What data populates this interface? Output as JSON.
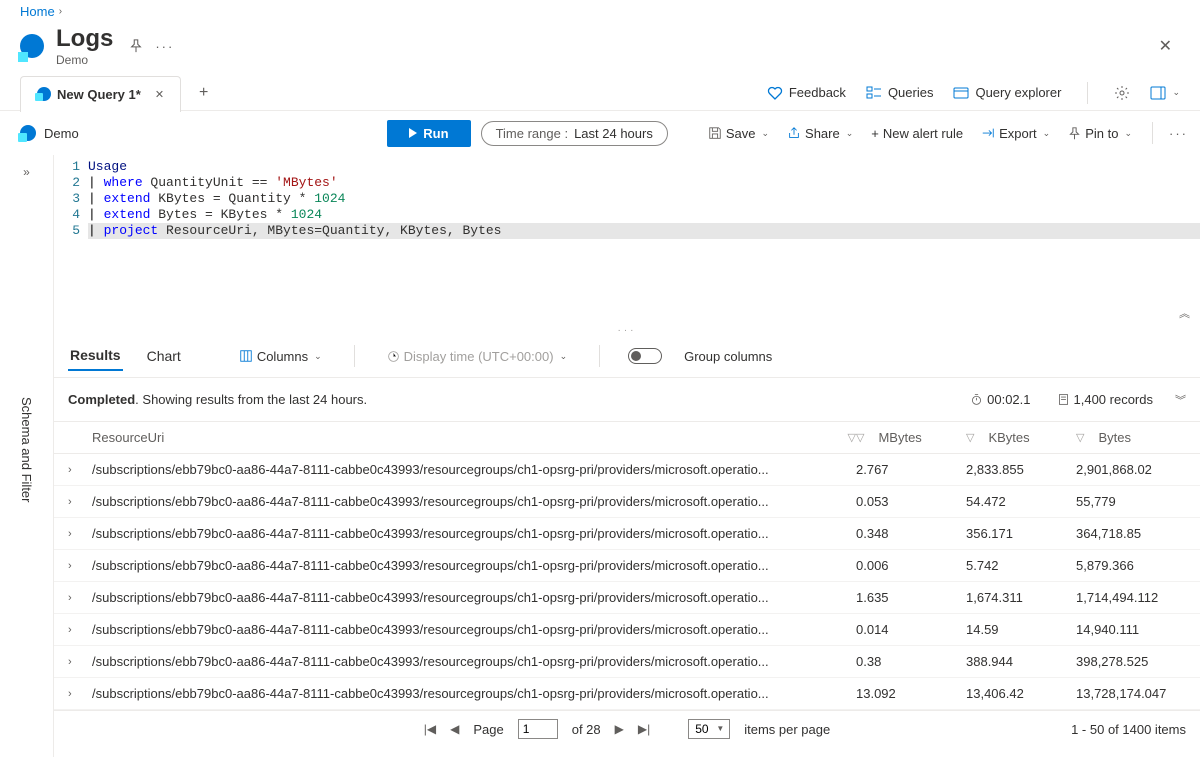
{
  "breadcrumb": {
    "home": "Home"
  },
  "title": {
    "main": "Logs",
    "sub": "Demo"
  },
  "tab": {
    "label": "New Query 1*"
  },
  "topright": {
    "feedback": "Feedback",
    "queries": "Queries",
    "explorer": "Query explorer"
  },
  "toolbar": {
    "scope": "Demo",
    "run": "Run",
    "timelabel": "Time range :",
    "timevalue": "Last 24 hours",
    "save": "Save",
    "share": "Share",
    "newalert": "New alert rule",
    "export": "Export",
    "pin": "Pin to"
  },
  "sidebar": {
    "label": "Schema and Filter"
  },
  "code": {
    "l1": "Usage",
    "l2_where": "where",
    "l2_rest": " QuantityUnit == ",
    "l2_str": "'MBytes'",
    "l3_extend": "extend",
    "l3_rest": " KBytes = Quantity * ",
    "l3_num": "1024",
    "l4_extend": "extend",
    "l4_rest": " Bytes = KBytes * ",
    "l4_num": "1024",
    "l5_project": "project",
    "l5_rest": " ResourceUri, MBytes=Quantity, KBytes, Bytes"
  },
  "results": {
    "tab_results": "Results",
    "tab_chart": "Chart",
    "columns": "Columns",
    "display_time": "Display time (UTC+00:00)",
    "group_cols": "Group columns",
    "status_bold": "Completed",
    "status_rest": ". Showing results from the last 24 hours.",
    "timing": "00:02.1",
    "records": "1,400 records",
    "headers": {
      "c1": "ResourceUri",
      "c2": "MBytes",
      "c3": "KBytes",
      "c4": "Bytes"
    },
    "rows": [
      {
        "uri": "/subscriptions/ebb79bc0-aa86-44a7-8111-cabbe0c43993/resourcegroups/ch1-opsrg-pri/providers/microsoft.operatio...",
        "mb": "2.767",
        "kb": "2,833.855",
        "b": "2,901,868.02"
      },
      {
        "uri": "/subscriptions/ebb79bc0-aa86-44a7-8111-cabbe0c43993/resourcegroups/ch1-opsrg-pri/providers/microsoft.operatio...",
        "mb": "0.053",
        "kb": "54.472",
        "b": "55,779"
      },
      {
        "uri": "/subscriptions/ebb79bc0-aa86-44a7-8111-cabbe0c43993/resourcegroups/ch1-opsrg-pri/providers/microsoft.operatio...",
        "mb": "0.348",
        "kb": "356.171",
        "b": "364,718.85"
      },
      {
        "uri": "/subscriptions/ebb79bc0-aa86-44a7-8111-cabbe0c43993/resourcegroups/ch1-opsrg-pri/providers/microsoft.operatio...",
        "mb": "0.006",
        "kb": "5.742",
        "b": "5,879.366"
      },
      {
        "uri": "/subscriptions/ebb79bc0-aa86-44a7-8111-cabbe0c43993/resourcegroups/ch1-opsrg-pri/providers/microsoft.operatio...",
        "mb": "1.635",
        "kb": "1,674.311",
        "b": "1,714,494.112"
      },
      {
        "uri": "/subscriptions/ebb79bc0-aa86-44a7-8111-cabbe0c43993/resourcegroups/ch1-opsrg-pri/providers/microsoft.operatio...",
        "mb": "0.014",
        "kb": "14.59",
        "b": "14,940.111"
      },
      {
        "uri": "/subscriptions/ebb79bc0-aa86-44a7-8111-cabbe0c43993/resourcegroups/ch1-opsrg-pri/providers/microsoft.operatio...",
        "mb": "0.38",
        "kb": "388.944",
        "b": "398,278.525"
      },
      {
        "uri": "/subscriptions/ebb79bc0-aa86-44a7-8111-cabbe0c43993/resourcegroups/ch1-opsrg-pri/providers/microsoft.operatio...",
        "mb": "13.092",
        "kb": "13,406.42",
        "b": "13,728,174.047"
      }
    ]
  },
  "pager": {
    "page_label": "Page",
    "page_value": "1",
    "of_total": "of 28",
    "per_value": "50",
    "per_label": "items per page",
    "summary": "1 - 50 of 1400 items"
  }
}
